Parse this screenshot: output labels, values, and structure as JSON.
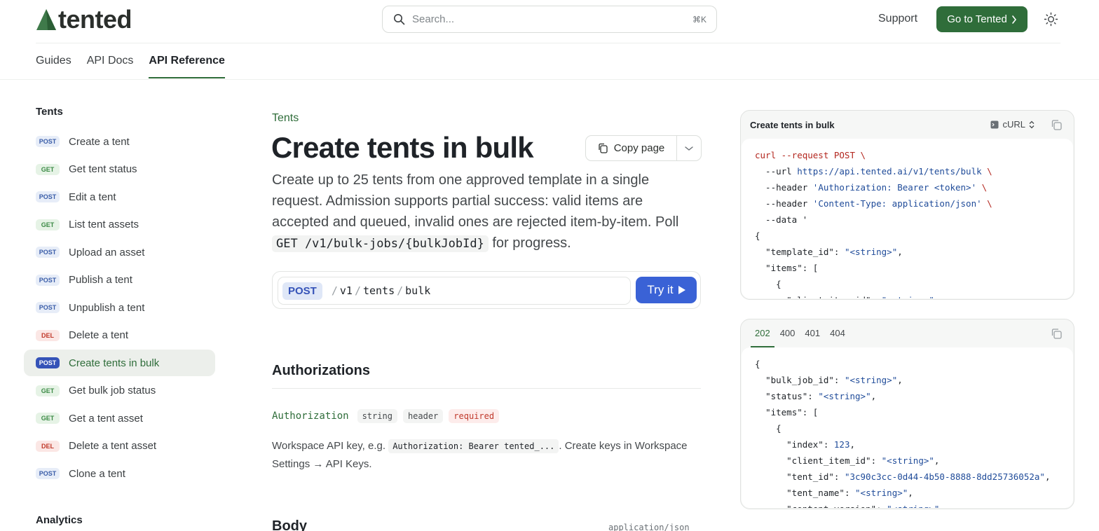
{
  "brand": {
    "name": "tented",
    "accent": "#2f6d3a"
  },
  "header": {
    "search_placeholder": "Search...",
    "search_shortcut": "⌘K",
    "support_label": "Support",
    "cta_label": "Go to Tented"
  },
  "nav": {
    "tabs": [
      "Guides",
      "API Docs",
      "API Reference"
    ],
    "active": "API Reference"
  },
  "sidebar": {
    "section_title": "Tents",
    "items": [
      {
        "method": "POST",
        "label": "Create a tent"
      },
      {
        "method": "GET",
        "label": "Get tent status"
      },
      {
        "method": "POST",
        "label": "Edit a tent"
      },
      {
        "method": "GET",
        "label": "List tent assets"
      },
      {
        "method": "POST",
        "label": "Upload an asset"
      },
      {
        "method": "POST",
        "label": "Publish a tent"
      },
      {
        "method": "POST",
        "label": "Unpublish a tent"
      },
      {
        "method": "DEL",
        "label": "Delete a tent"
      },
      {
        "method": "POST",
        "label": "Create tents in bulk"
      },
      {
        "method": "GET",
        "label": "Get bulk job status"
      },
      {
        "method": "GET",
        "label": "Get a tent asset"
      },
      {
        "method": "DEL",
        "label": "Delete a tent asset"
      },
      {
        "method": "POST",
        "label": "Clone a tent"
      }
    ],
    "next_section_title": "Analytics"
  },
  "main": {
    "breadcrumb": "Tents",
    "title": "Create tents in bulk",
    "copy_page_label": "Copy page",
    "description_parts": [
      "Create up to 25 tents from one approved template in a single request. Admission supports partial success: valid items are accepted and queued, invalid ones are rejected item-by-item. Poll ",
      "GET /v1/bulk-jobs/{bulkJobId}",
      " for progress."
    ],
    "endpoint": {
      "method": "POST",
      "path_segments": [
        "v1",
        "tents",
        "bulk"
      ],
      "try_label": "Try it"
    },
    "authorizations_title": "Authorizations",
    "auth_param": {
      "name": "Authorization",
      "type": "string",
      "location": "header",
      "required": "required",
      "desc_before": "Workspace API key, e.g. ",
      "desc_code": "Authorization: Bearer tented_...",
      "desc_after": ". Create keys in Workspace Settings → API Keys."
    },
    "body_title": "Body",
    "body_type": "application/json"
  },
  "request_panel": {
    "title": "Create tents in bulk",
    "language": "cURL",
    "code_lines": [
      "curl --request POST \\",
      "  --url https://api.tented.ai/v1/tents/bulk \\",
      "  --header 'Authorization: Bearer <token>' \\",
      "  --header 'Content-Type: application/json' \\",
      "  --data '",
      "{",
      "  \"template_id\": \"<string>\",",
      "  \"items\": [",
      "    {",
      "      \"client_item_id\": \"<string>\","
    ]
  },
  "response_panel": {
    "tabs": [
      "202",
      "400",
      "401",
      "404"
    ],
    "active": "202",
    "code_lines": [
      "{",
      "  \"bulk_job_id\": \"<string>\",",
      "  \"status\": \"<string>\",",
      "  \"items\": [",
      "    {",
      "      \"index\": 123,",
      "      \"client_item_id\": \"<string>\",",
      "      \"tent_id\": \"3c90c3cc-0d44-4b50-8888-8dd25736052a\",",
      "      \"tent_name\": \"<string>\",",
      "      \"content_version\": \"<string>\","
    ]
  }
}
